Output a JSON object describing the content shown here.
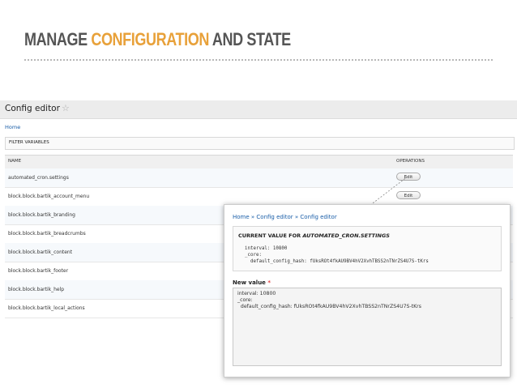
{
  "slide": {
    "title_prefix": "MANAGE ",
    "title_accent": "CONFIGURATION",
    "title_suffix": " AND STATE",
    "accent_color": "#e8a13a"
  },
  "config_editor": {
    "title": "Config editor",
    "star_icon": "star-outline-icon",
    "home_link": "Home",
    "filter_label": "FILTER VARIABLES",
    "columns": {
      "name": "NAME",
      "operations": "OPERATIONS"
    },
    "rows": [
      {
        "name": "automated_cron.settings",
        "action": "Edit"
      },
      {
        "name": "block.block.bartik_account_menu",
        "action": "Edit"
      },
      {
        "name": "block.block.bartik_branding"
      },
      {
        "name": "block.block.bartik_breadcrumbs"
      },
      {
        "name": "block.block.bartik_content"
      },
      {
        "name": "block.block.bartik_footer"
      },
      {
        "name": "block.block.bartik_help"
      },
      {
        "name": "block.block.bartik_local_actions"
      }
    ]
  },
  "edit_screen": {
    "breadcrumb": "Home » Config editor » Config editor",
    "current_legend_prefix": "CURRENT VALUE FOR ",
    "current_legend_name": "AUTOMATED_CRON.SETTINGS",
    "current_value": "interval: 10800\n_core:\n  default_config_hash: fUksROt4fkAU9BV4hV2XvhTBSS2nTNrZS4U7S-tKrs",
    "new_value_label": "New value",
    "required_marker": "*",
    "new_value": "interval: 10800\n_core:\n  default_config_hash: fUksROt4fkAU9BV4hV2XvhTBSS2nTNrZS4U7S-tKrs"
  }
}
